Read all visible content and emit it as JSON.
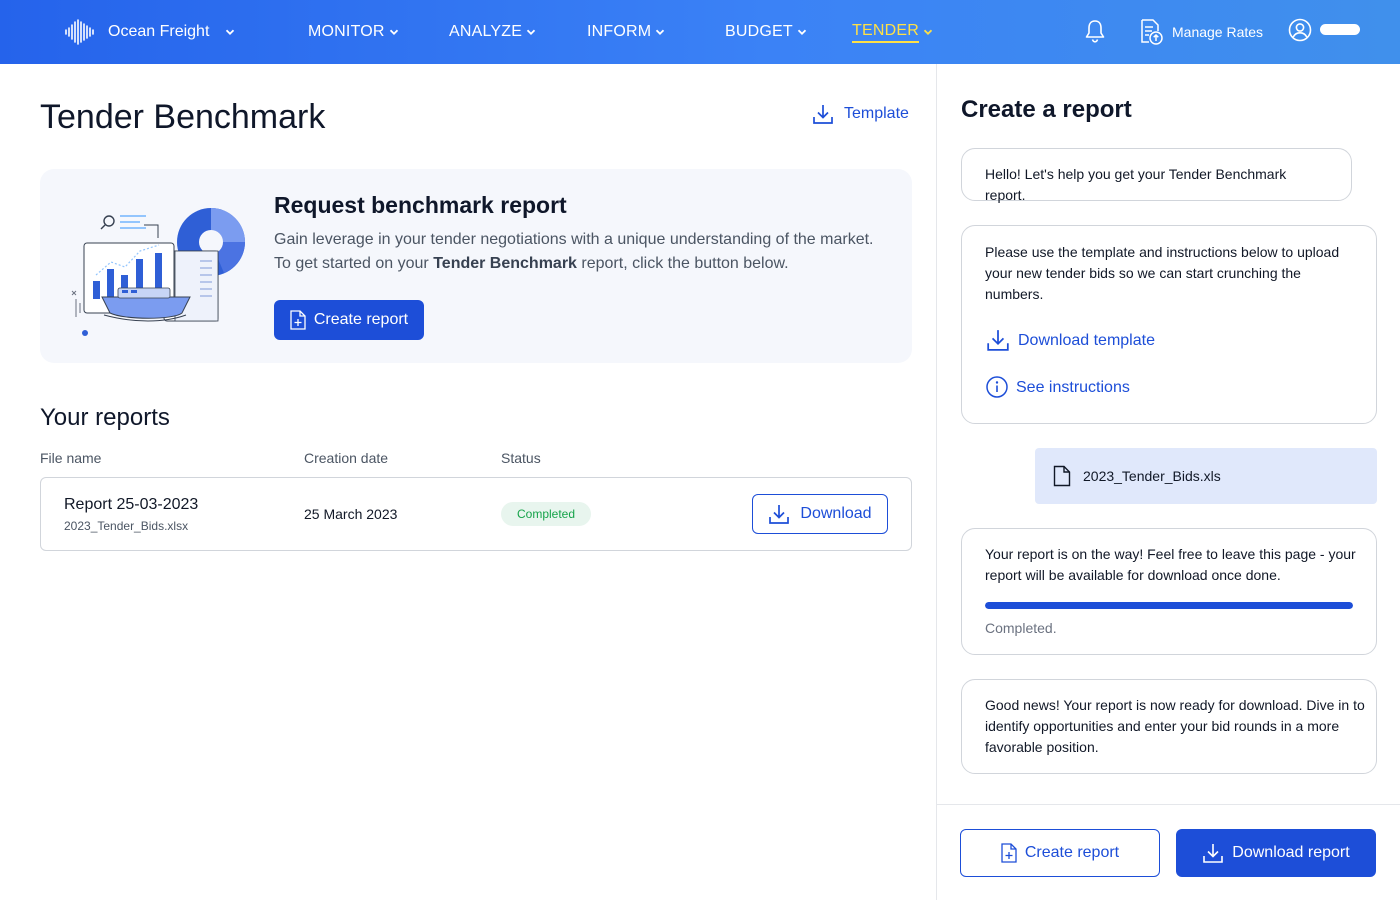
{
  "nav": {
    "brand": "Ocean Freight",
    "items": [
      {
        "label": "MONITOR"
      },
      {
        "label": "ANALYZE"
      },
      {
        "label": "INFORM"
      },
      {
        "label": "BUDGET"
      },
      {
        "label": "TENDER",
        "active": true
      }
    ],
    "manage_rates": "Manage Rates",
    "active_color": "#fde047"
  },
  "page": {
    "title": "Tender Benchmark",
    "template_link": "Template"
  },
  "promo": {
    "title": "Request benchmark report",
    "desc_line1": "Gain leverage in your tender negotiations with a unique understanding of the market.",
    "desc_prefix": "To get started on your ",
    "desc_bold": "Tender Benchmark",
    "desc_suffix": " report, click the button below.",
    "button": "Create report"
  },
  "reports": {
    "title": "Your reports",
    "columns": [
      "File name",
      "Creation date",
      "Status"
    ],
    "rows": [
      {
        "name": "Report 25-03-2023",
        "file": "2023_Tender_Bids.xlsx",
        "date": "25 March 2023",
        "status": "Completed",
        "action": "Download"
      }
    ]
  },
  "panel": {
    "title": "Create a report",
    "msg_hello": "Hello! Let's help you get your Tender Benchmark report.",
    "msg_instructions": "Please use the template and instructions below to upload your new tender bids so we can start crunching the numbers.",
    "link_download_template": "Download template",
    "link_instructions": "See instructions",
    "uploaded_file": "2023_Tender_Bids.xls",
    "msg_progress": "Your report is on the way! Feel free to leave this page - your report will be available for download once done.",
    "progress_percent": 100,
    "progress_label": "Completed.",
    "msg_ready": "Good news! Your report is now ready for download. Dive in to identify opportunities and enter your bid rounds in a more favorable position.",
    "btn_create": "Create report",
    "btn_download": "Download report"
  },
  "colors": {
    "primary": "#1d4ed8",
    "nav_gradient_start": "#2563eb",
    "nav_gradient_end": "#4090ec",
    "status_completed": "#16a34a"
  },
  "icons": [
    "ocean-freight-logo",
    "chevron-down-icon",
    "bell-icon",
    "manage-rates-icon",
    "user-icon",
    "download-icon",
    "file-plus-icon",
    "info-icon",
    "file-icon"
  ]
}
